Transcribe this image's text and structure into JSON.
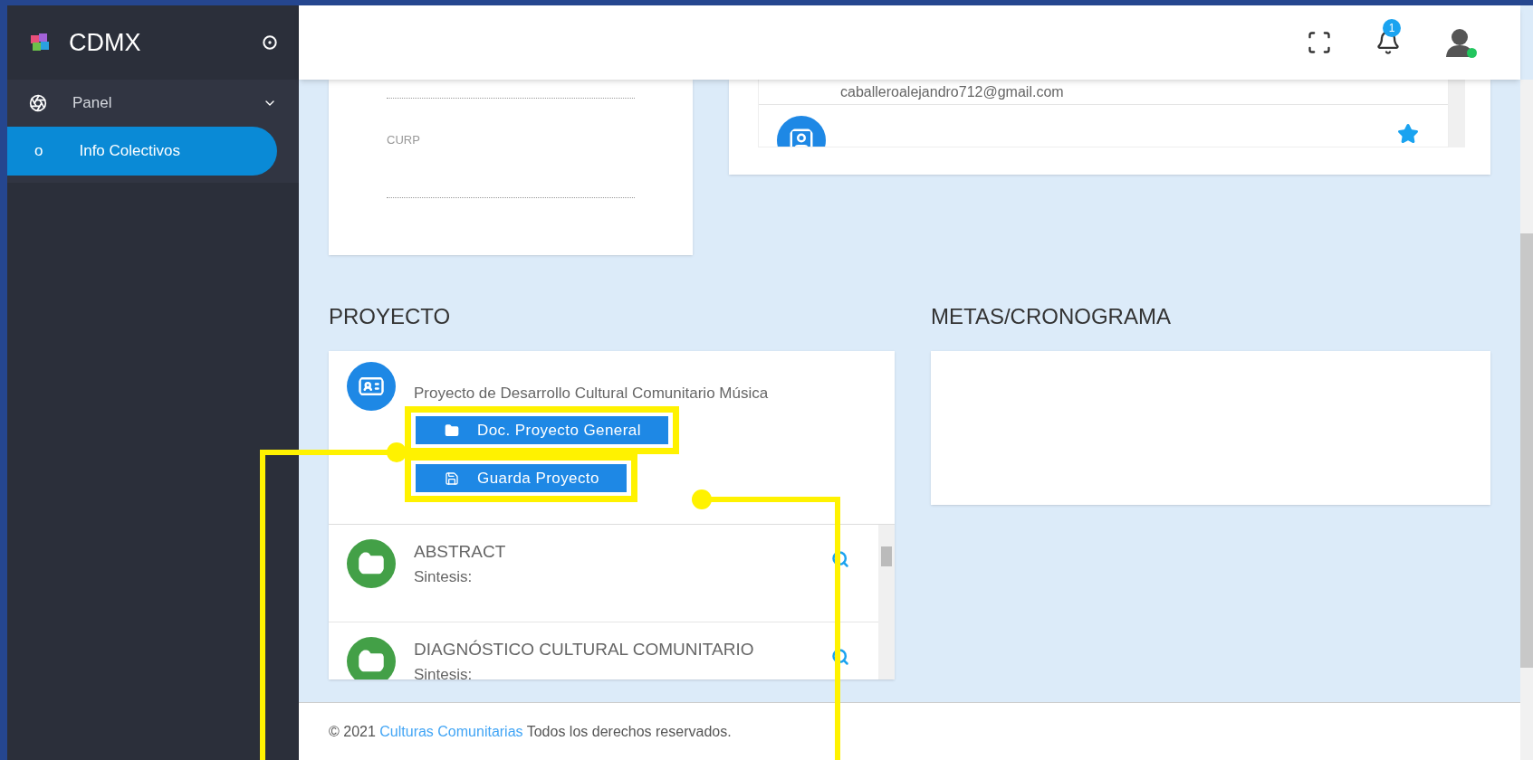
{
  "sidebar": {
    "brand": "CDMX",
    "items": [
      {
        "label": "Panel",
        "expanded": true,
        "children": [
          {
            "label": "Info Colectivos",
            "bullet": "o",
            "selected": true
          }
        ]
      }
    ]
  },
  "header": {
    "notification_count": "1"
  },
  "personal_card": {
    "field_label": "CURP"
  },
  "members_card": {
    "email": "caballeroalejandro712@gmail.com",
    "starred": true
  },
  "proyecto": {
    "title": "PROYECTO",
    "name": "Proyecto de Desarrollo Cultural Comunitario Música",
    "buttons": [
      {
        "kind": "folder",
        "label": "Doc. Proyecto General"
      },
      {
        "kind": "save",
        "label": "Guarda Proyecto"
      }
    ],
    "sections": [
      {
        "title": "ABSTRACT",
        "subtitle": "Sintesis:"
      },
      {
        "title": "DIAGNÓSTICO CULTURAL COMUNITARIO",
        "subtitle": "Sintesis:"
      }
    ]
  },
  "metas": {
    "title": "METAS/CRONOGRAMA"
  },
  "footer": {
    "year": "© 2021",
    "link": "Culturas Comunitarias",
    "rights": "Todos los derechos reservados."
  }
}
